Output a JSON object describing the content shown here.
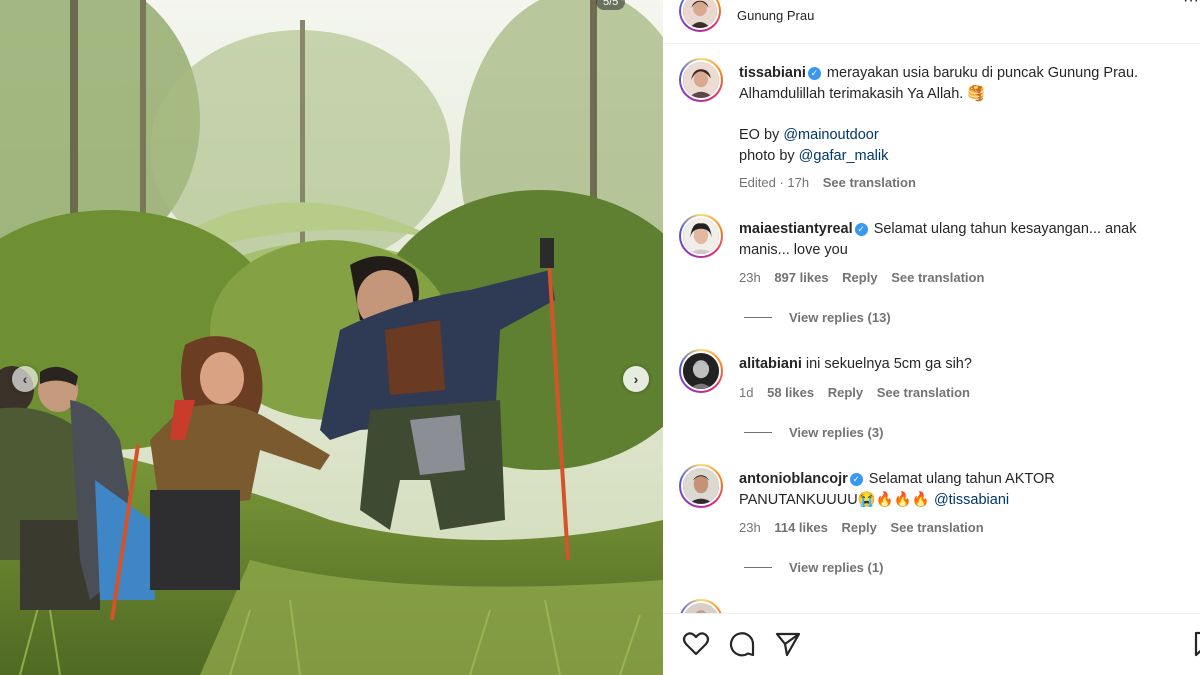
{
  "photo": {
    "counter": "5/5",
    "prev_icon": "chevron-left-icon",
    "next_icon": "chevron-right-icon"
  },
  "header": {
    "location": "Gunung Prau",
    "more_icon": "more-icon"
  },
  "caption": {
    "username": "tissabiani",
    "verified": true,
    "line1": "merayakan usia baruku di puncak Gunung Prau.",
    "line2": "Alhamdulillah terimakasih Ya Allah. 🥞",
    "eo_prefix": "EO by ",
    "eo_mention": "@mainoutdoor",
    "photo_prefix": "photo by ",
    "photo_mention": "@gafar_malik",
    "edited": "Edited · 17h",
    "see_translation": "See translation"
  },
  "comments": [
    {
      "username": "maiaestiantyreal",
      "verified": true,
      "text": "Selamat ulang tahun kesayangan... anak manis... love you",
      "time": "23h",
      "likes": "897 likes",
      "reply": "Reply",
      "see_translation": "See translation",
      "view_replies": "View replies (13)"
    },
    {
      "username": "alitabiani",
      "verified": false,
      "text": "ini sekuelnya 5cm ga sih?",
      "time": "1d",
      "likes": "58 likes",
      "reply": "Reply",
      "see_translation": "See translation",
      "view_replies": "View replies (3)"
    },
    {
      "username": "antonioblancojr",
      "verified": true,
      "text_line1": "Selamat ulang tahun AKTOR",
      "text_line2": "PANUTANKUUUU😭🔥🔥🔥 ",
      "mention": "@tissabiani",
      "time": "23h",
      "likes": "114 likes",
      "reply": "Reply",
      "see_translation": "See translation",
      "view_replies": "View replies (1)"
    }
  ],
  "actions": {
    "like_icon": "heart-icon",
    "comment_icon": "comment-icon",
    "share_icon": "share-icon",
    "save_icon": "bookmark-icon"
  },
  "colors": {
    "accent_link": "#00376b",
    "verified": "#3897f0",
    "meta_text": "#737373"
  }
}
